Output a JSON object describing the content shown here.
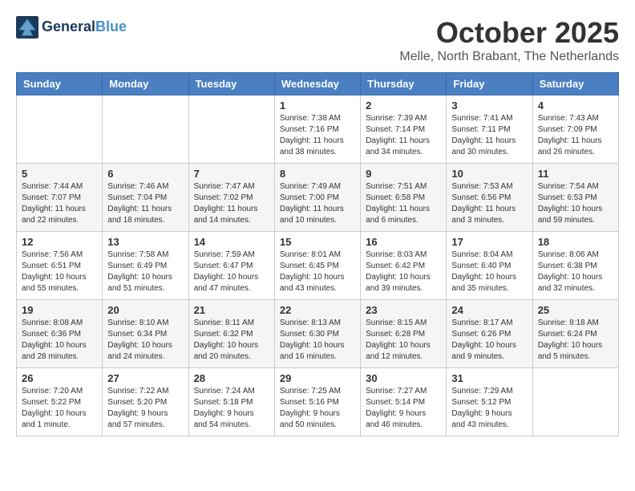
{
  "header": {
    "logo_line1": "General",
    "logo_line2": "Blue",
    "month_title": "October 2025",
    "location": "Melle, North Brabant, The Netherlands"
  },
  "days_of_week": [
    "Sunday",
    "Monday",
    "Tuesday",
    "Wednesday",
    "Thursday",
    "Friday",
    "Saturday"
  ],
  "weeks": [
    [
      {
        "day": "",
        "info": ""
      },
      {
        "day": "",
        "info": ""
      },
      {
        "day": "",
        "info": ""
      },
      {
        "day": "1",
        "info": "Sunrise: 7:38 AM\nSunset: 7:16 PM\nDaylight: 11 hours\nand 38 minutes."
      },
      {
        "day": "2",
        "info": "Sunrise: 7:39 AM\nSunset: 7:14 PM\nDaylight: 11 hours\nand 34 minutes."
      },
      {
        "day": "3",
        "info": "Sunrise: 7:41 AM\nSunset: 7:11 PM\nDaylight: 11 hours\nand 30 minutes."
      },
      {
        "day": "4",
        "info": "Sunrise: 7:43 AM\nSunset: 7:09 PM\nDaylight: 11 hours\nand 26 minutes."
      }
    ],
    [
      {
        "day": "5",
        "info": "Sunrise: 7:44 AM\nSunset: 7:07 PM\nDaylight: 11 hours\nand 22 minutes."
      },
      {
        "day": "6",
        "info": "Sunrise: 7:46 AM\nSunset: 7:04 PM\nDaylight: 11 hours\nand 18 minutes."
      },
      {
        "day": "7",
        "info": "Sunrise: 7:47 AM\nSunset: 7:02 PM\nDaylight: 11 hours\nand 14 minutes."
      },
      {
        "day": "8",
        "info": "Sunrise: 7:49 AM\nSunset: 7:00 PM\nDaylight: 11 hours\nand 10 minutes."
      },
      {
        "day": "9",
        "info": "Sunrise: 7:51 AM\nSunset: 6:58 PM\nDaylight: 11 hours\nand 6 minutes."
      },
      {
        "day": "10",
        "info": "Sunrise: 7:53 AM\nSunset: 6:56 PM\nDaylight: 11 hours\nand 3 minutes."
      },
      {
        "day": "11",
        "info": "Sunrise: 7:54 AM\nSunset: 6:53 PM\nDaylight: 10 hours\nand 59 minutes."
      }
    ],
    [
      {
        "day": "12",
        "info": "Sunrise: 7:56 AM\nSunset: 6:51 PM\nDaylight: 10 hours\nand 55 minutes."
      },
      {
        "day": "13",
        "info": "Sunrise: 7:58 AM\nSunset: 6:49 PM\nDaylight: 10 hours\nand 51 minutes."
      },
      {
        "day": "14",
        "info": "Sunrise: 7:59 AM\nSunset: 6:47 PM\nDaylight: 10 hours\nand 47 minutes."
      },
      {
        "day": "15",
        "info": "Sunrise: 8:01 AM\nSunset: 6:45 PM\nDaylight: 10 hours\nand 43 minutes."
      },
      {
        "day": "16",
        "info": "Sunrise: 8:03 AM\nSunset: 6:42 PM\nDaylight: 10 hours\nand 39 minutes."
      },
      {
        "day": "17",
        "info": "Sunrise: 8:04 AM\nSunset: 6:40 PM\nDaylight: 10 hours\nand 35 minutes."
      },
      {
        "day": "18",
        "info": "Sunrise: 8:06 AM\nSunset: 6:38 PM\nDaylight: 10 hours\nand 32 minutes."
      }
    ],
    [
      {
        "day": "19",
        "info": "Sunrise: 8:08 AM\nSunset: 6:36 PM\nDaylight: 10 hours\nand 28 minutes."
      },
      {
        "day": "20",
        "info": "Sunrise: 8:10 AM\nSunset: 6:34 PM\nDaylight: 10 hours\nand 24 minutes."
      },
      {
        "day": "21",
        "info": "Sunrise: 8:11 AM\nSunset: 6:32 PM\nDaylight: 10 hours\nand 20 minutes."
      },
      {
        "day": "22",
        "info": "Sunrise: 8:13 AM\nSunset: 6:30 PM\nDaylight: 10 hours\nand 16 minutes."
      },
      {
        "day": "23",
        "info": "Sunrise: 8:15 AM\nSunset: 6:28 PM\nDaylight: 10 hours\nand 12 minutes."
      },
      {
        "day": "24",
        "info": "Sunrise: 8:17 AM\nSunset: 6:26 PM\nDaylight: 10 hours\nand 9 minutes."
      },
      {
        "day": "25",
        "info": "Sunrise: 8:18 AM\nSunset: 6:24 PM\nDaylight: 10 hours\nand 5 minutes."
      }
    ],
    [
      {
        "day": "26",
        "info": "Sunrise: 7:20 AM\nSunset: 5:22 PM\nDaylight: 10 hours\nand 1 minute."
      },
      {
        "day": "27",
        "info": "Sunrise: 7:22 AM\nSunset: 5:20 PM\nDaylight: 9 hours\nand 57 minutes."
      },
      {
        "day": "28",
        "info": "Sunrise: 7:24 AM\nSunset: 5:18 PM\nDaylight: 9 hours\nand 54 minutes."
      },
      {
        "day": "29",
        "info": "Sunrise: 7:25 AM\nSunset: 5:16 PM\nDaylight: 9 hours\nand 50 minutes."
      },
      {
        "day": "30",
        "info": "Sunrise: 7:27 AM\nSunset: 5:14 PM\nDaylight: 9 hours\nand 46 minutes."
      },
      {
        "day": "31",
        "info": "Sunrise: 7:29 AM\nSunset: 5:12 PM\nDaylight: 9 hours\nand 43 minutes."
      },
      {
        "day": "",
        "info": ""
      }
    ]
  ]
}
